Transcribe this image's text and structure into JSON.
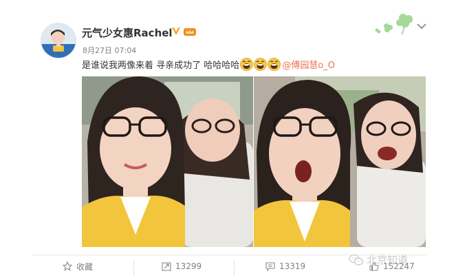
{
  "post": {
    "username": "元气少女惠Rachel",
    "timestamp": "8月27日 07:04",
    "text": "是谁说我两像来着 寻亲成功了 哈哈哈哈",
    "mention": "@傅园慧o_O",
    "emoji_count": 3,
    "colors": {
      "mention": "#eb7350",
      "verify_badge": "#f5a623",
      "accent_yellow": "#f2c53d"
    }
  },
  "actions": {
    "favorite_label": "收藏",
    "repost_count": "13299",
    "comment_count": "13319",
    "like_count": "152247"
  },
  "watermark": {
    "text": "北京知道"
  },
  "icons": [
    "avatar",
    "verified-v-icon",
    "member-crown-icon",
    "clover-decoration-icon",
    "chevron-down-icon",
    "laugh-emoji-icon",
    "star-icon",
    "repost-icon",
    "comment-icon",
    "like-icon",
    "wechat-icon"
  ]
}
